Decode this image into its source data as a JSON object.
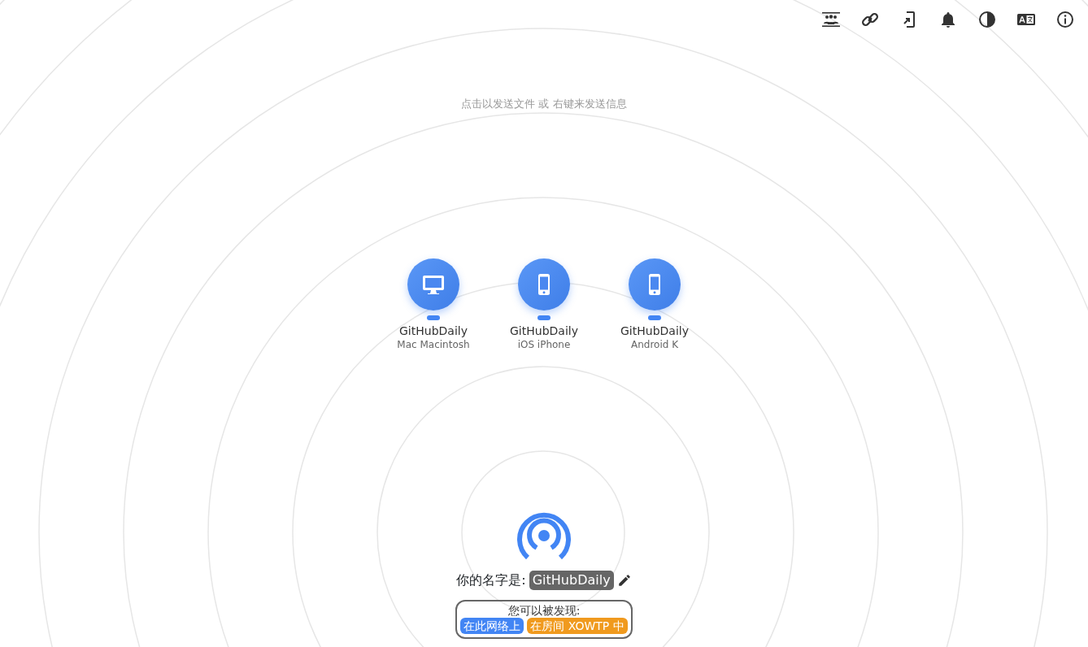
{
  "hint": "点击以发送文件 或 右键来发送信息",
  "peers": [
    {
      "kind": "desktop",
      "name": "GitHubDaily",
      "device": "Mac Macintosh"
    },
    {
      "kind": "phone",
      "name": "GitHubDaily",
      "device": "iOS iPhone"
    },
    {
      "kind": "phone",
      "name": "GitHubDaily",
      "device": "Android K"
    }
  ],
  "own_name": {
    "label": "你的名字是:",
    "value": "GitHubDaily"
  },
  "discovery": {
    "title": "您可以被发现:",
    "badges": [
      {
        "text": "在此网络上",
        "color": "#4285f4"
      },
      {
        "text": "在房间 XOWTP 中",
        "color": "#f09a1e"
      }
    ]
  }
}
